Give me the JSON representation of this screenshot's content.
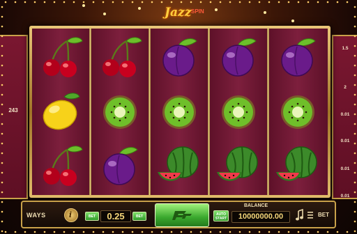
{
  "game": {
    "logo_main": "Jazz",
    "logo_sub": "SPIN"
  },
  "left_panel": {
    "ways_count": "243"
  },
  "right_panel": {
    "paytable_values": [
      "1.5",
      "2",
      "0.01",
      "0.01",
      "0.01",
      "0.01"
    ]
  },
  "reels": [
    [
      "cherry",
      "lemon",
      "cherry"
    ],
    [
      "cherry",
      "kiwi",
      "plum"
    ],
    [
      "plum",
      "kiwi",
      "watermelon"
    ],
    [
      "plum",
      "kiwi",
      "watermelon"
    ],
    [
      "plum",
      "kiwi",
      "watermelon"
    ]
  ],
  "bottom_bar": {
    "ways_label": "WAYS",
    "info_icon": "info-icon",
    "bet_minus_label": "BET",
    "bet_value": "0.25",
    "bet_plus_label": "BET",
    "spin_icon": "spin-logo-icon",
    "auto_start_label": "AUTO START",
    "balance_label": "BALANCE",
    "balance_value": "10000000.00",
    "sound_icon": "music-note-icon",
    "menu_icon": "menu-icon",
    "bet_label": "BET"
  },
  "colors": {
    "reel_bg": "#7d1f3d",
    "frame_gold": "#c9a24a",
    "accent_green": "#4cc13a",
    "value_text": "#f5d77a"
  }
}
